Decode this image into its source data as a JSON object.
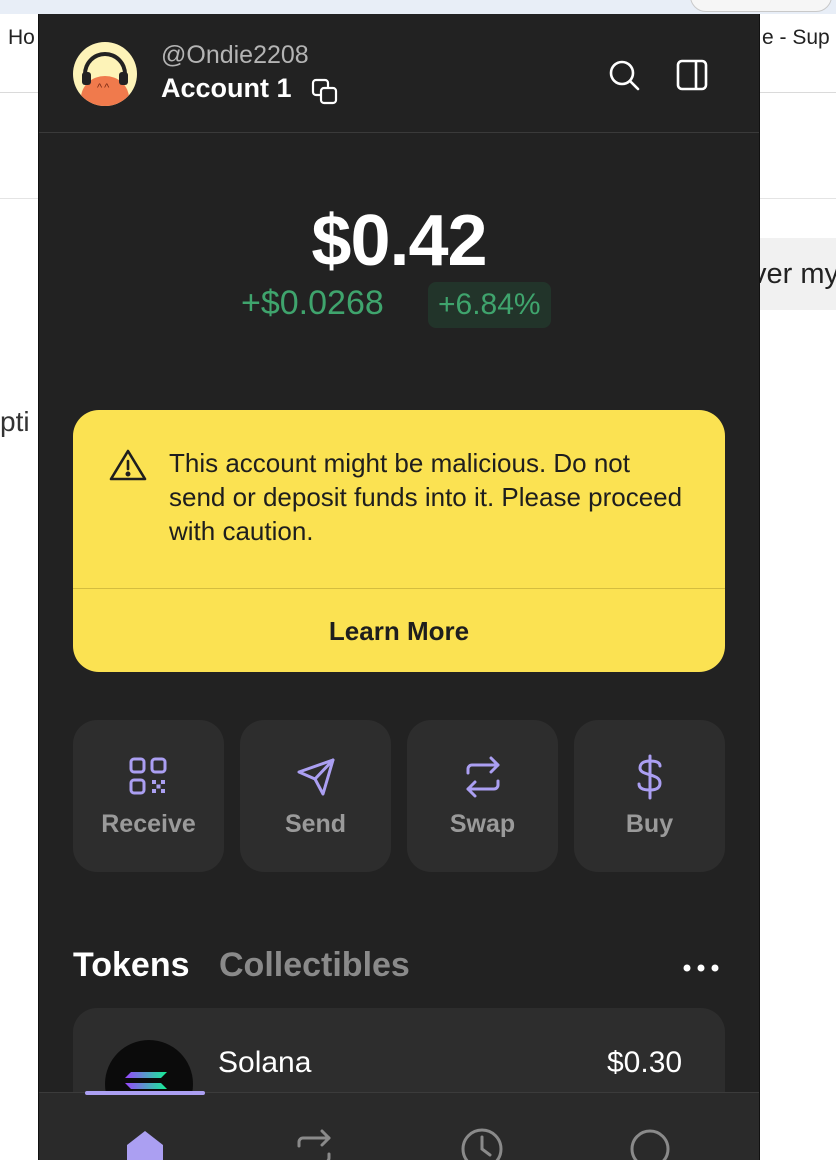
{
  "background": {
    "nav_left_text": "Ho",
    "nav_right_text": "e - Sup",
    "box_text": "ver my",
    "left_text": "pti"
  },
  "wallet": {
    "header": {
      "handle": "@Ondie2208",
      "account_name": "Account 1"
    },
    "balance": {
      "total": "$0.42",
      "change": "+$0.0268",
      "percent": "+6.84%"
    },
    "warning": {
      "message": "This account might be malicious. Do not send or deposit funds into it. Please proceed with caution.",
      "button": "Learn More"
    },
    "actions": [
      {
        "label": "Receive",
        "icon": "qr-code-icon"
      },
      {
        "label": "Send",
        "icon": "send-icon"
      },
      {
        "label": "Swap",
        "icon": "swap-icon"
      },
      {
        "label": "Buy",
        "icon": "dollar-icon"
      }
    ],
    "tabs": {
      "tokens": "Tokens",
      "collectibles": "Collectibles"
    },
    "tokens": [
      {
        "name": "Solana",
        "value": "$0.30"
      }
    ],
    "bottom_nav": [
      "home-icon",
      "swap-icon",
      "history-icon",
      "search-icon"
    ],
    "colors": {
      "accent": "#ab9ff2",
      "panel": "#222222",
      "card": "#2d2d2d",
      "warning": "#fbe252",
      "positive": "#3fa46d"
    }
  }
}
